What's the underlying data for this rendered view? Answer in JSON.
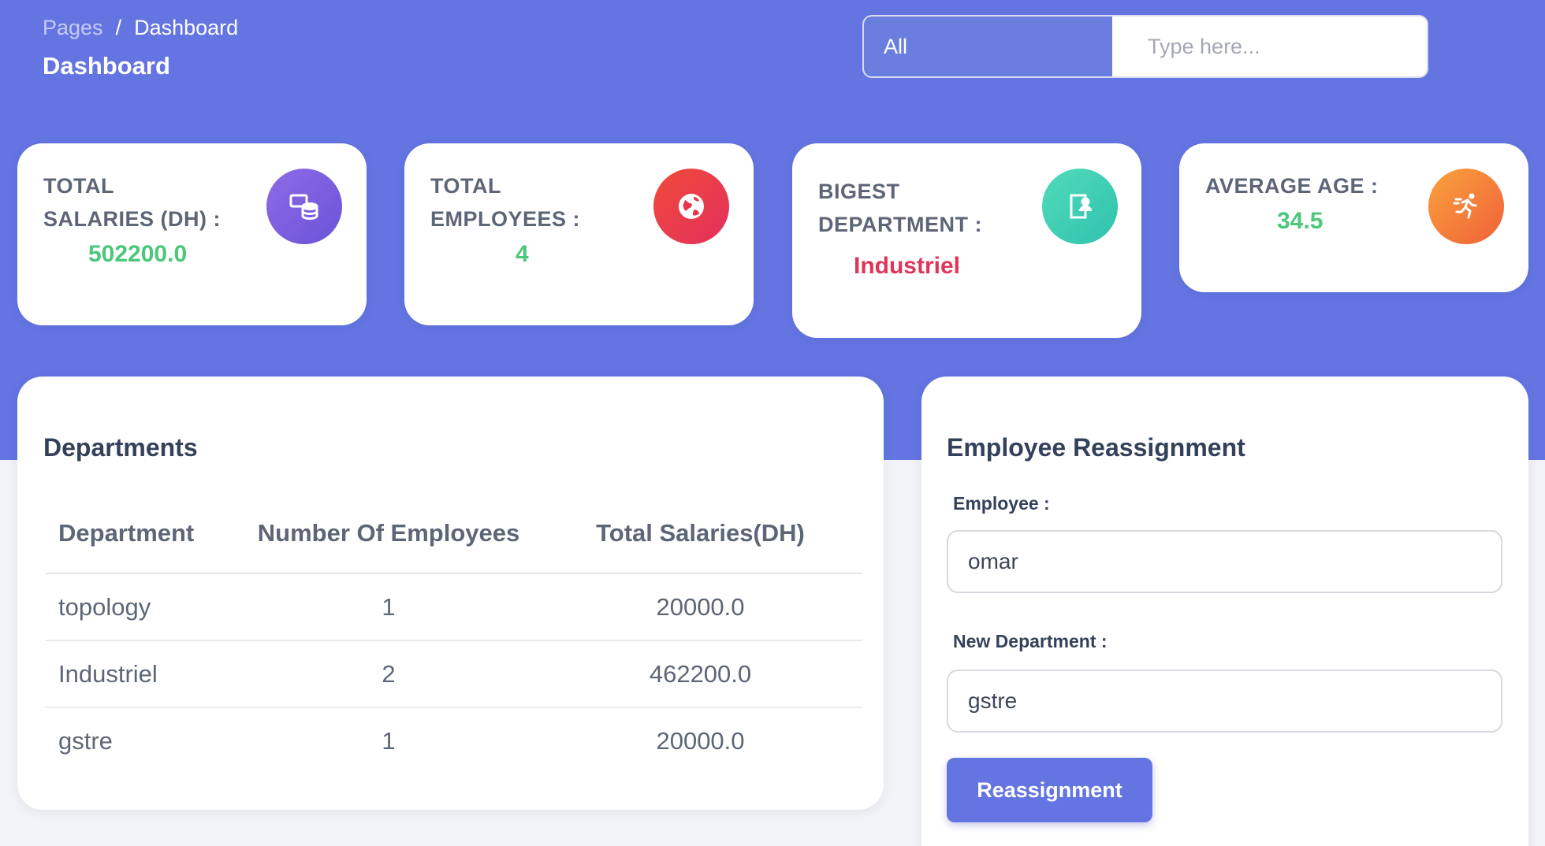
{
  "breadcrumb": {
    "parent": "Pages",
    "separator": "/",
    "current": "Dashboard"
  },
  "page_title": "Dashboard",
  "search": {
    "filter_value": "All",
    "placeholder": "Type here..."
  },
  "stats": {
    "total_salaries": {
      "label_line1": "TOTAL",
      "label_line2": "SALARIES (DH) :",
      "value": "502200.0",
      "icon": "coins-icon",
      "color": "#7b5fe0"
    },
    "total_employees": {
      "label_line1": "TOTAL",
      "label_line2": "EMPLOYEES :",
      "value": "4",
      "icon": "globe-icon",
      "color": "#ea3b4e"
    },
    "biggest_department": {
      "label_line1": "BIGEST",
      "label_line2": "DEPARTMENT :",
      "value": "Industriel",
      "icon": "profile-book-icon",
      "color": "#3ecfb4"
    },
    "average_age": {
      "label_line1": "AVERAGE AGE :",
      "value": "34.5",
      "icon": "running-icon",
      "color": "#f78238"
    }
  },
  "departments": {
    "title": "Departments",
    "columns": [
      "Department",
      "Number Of Employees",
      "Total Salaries(DH)"
    ],
    "rows": [
      [
        "topology",
        "1",
        "20000.0"
      ],
      [
        "Industriel",
        "2",
        "462200.0"
      ],
      [
        "gstre",
        "1",
        "20000.0"
      ]
    ]
  },
  "reassignment": {
    "title": "Employee Reassignment",
    "employee_label": "Employee :",
    "employee_value": "omar",
    "department_label": "New Department :",
    "department_value": "gstre",
    "button_label": "Reassignment"
  }
}
